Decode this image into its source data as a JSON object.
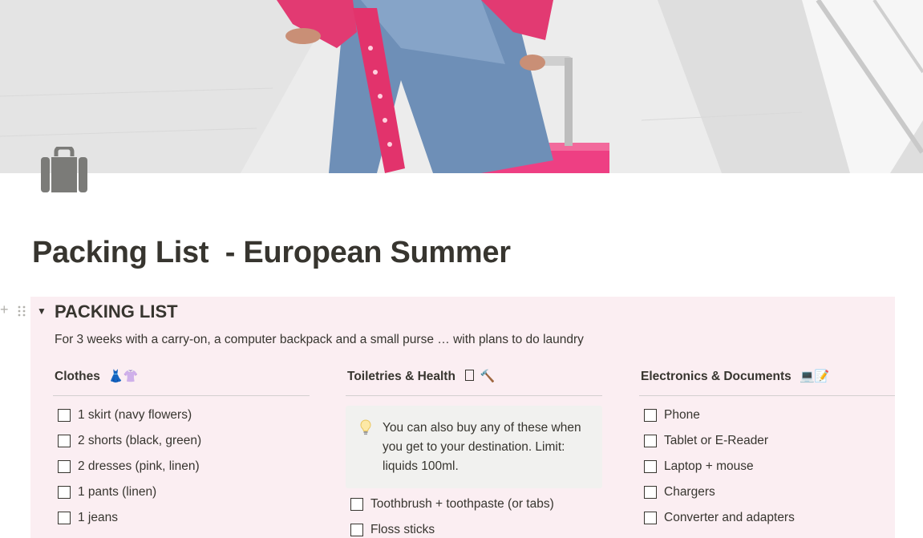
{
  "cover": {
    "icon": "photo-traveler-with-pink-suitcase"
  },
  "page_icon": {
    "icon": "luggage-icon",
    "color": "#7b7b78"
  },
  "title": "Packing List  - European Summer",
  "toggle": {
    "heading": "PACKING LIST",
    "description": "For 3 weeks with a carry-on, a computer backpack and a small purse … with plans to do laundry",
    "background": "#fbeef2"
  },
  "columns": {
    "clothes": {
      "title": "Clothes",
      "emoji": "👗👚",
      "items": [
        "1 skirt (navy flowers)",
        "2 shorts (black, green)",
        "2 dresses (pink, linen)",
        "1 pants (linen)",
        "1 jeans"
      ]
    },
    "toiletries": {
      "title": "Toiletries & Health",
      "emoji": "🔨",
      "callout": {
        "icon": "lightbulb-icon",
        "text": "You can also buy any of these when you get to your destination. Limit: liquids 100ml."
      },
      "items": [
        "Toothbrush + toothpaste (or tabs)",
        "Floss sticks"
      ]
    },
    "electronics": {
      "title": "Electronics & Documents",
      "emoji": "💻📝",
      "items": [
        "Phone",
        "Tablet or E-Reader",
        "Laptop + mouse",
        "Chargers",
        "Converter and adapters"
      ]
    }
  }
}
